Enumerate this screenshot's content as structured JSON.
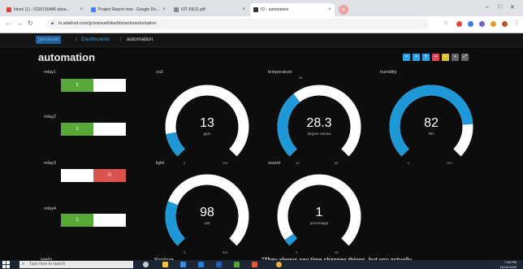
{
  "browser": {
    "tabs": [
      {
        "label": "Inbox (1) - 0120150486 adoa...",
        "color": "#d84437"
      },
      {
        "label": "Project Report new - Google Do...",
        "color": "#4285f4"
      },
      {
        "label": "IOT-65(1) pdf",
        "color": "#888888"
      },
      {
        "label": "IO - automation",
        "color": "#333333"
      }
    ],
    "new_tab": "+",
    "url": "io.adafruit.com/jyovwsuel/dashboards/automation",
    "window_controls": [
      "–",
      "□",
      "✕"
    ]
  },
  "app": {
    "breadcrumb": {
      "home": "jyovasuel",
      "sep": "/",
      "dashboards": "Dashboards",
      "current": "automation"
    },
    "title": "automation",
    "tool_icons": [
      {
        "name": "edit-icon",
        "glyph": "▪",
        "color": "#2aa5e6"
      },
      {
        "name": "settings-icon",
        "glyph": "▪",
        "color": "#2aa5e6"
      },
      {
        "name": "add-block-icon",
        "glyph": "+",
        "color": "#2aa5e6"
      },
      {
        "name": "delete-icon",
        "glyph": "▪",
        "color": "#e04a5a"
      },
      {
        "name": "key-icon",
        "glyph": "▪",
        "color": "#d9c531"
      },
      {
        "name": "lock-icon",
        "glyph": "▪",
        "color": "#666666"
      },
      {
        "name": "fullscreen-icon",
        "glyph": "⤢",
        "color": "#666666"
      }
    ],
    "relays": [
      {
        "label": "relay1",
        "on_text": "1",
        "off_text": "",
        "state": "on"
      },
      {
        "label": "relay2",
        "on_text": "1",
        "off_text": "",
        "state": "on"
      },
      {
        "label": "relay3",
        "on_text": "",
        "off_text": "0",
        "state": "off"
      },
      {
        "label": "relay4",
        "on_text": "1",
        "off_text": "",
        "state": "on"
      }
    ],
    "gauges": [
      {
        "label": "co2",
        "value": "13",
        "unit": "ppm",
        "min": "0",
        "max": "100",
        "mid": "",
        "fraction": 0.13
      },
      {
        "label": "temperature",
        "value": "28.3",
        "unit": "degree celcius",
        "min": "16",
        "max": "50",
        "mid": "26",
        "fraction": 0.36
      },
      {
        "label": "humidity",
        "value": "82",
        "unit": "RH",
        "min": "0",
        "max": "100",
        "mid": "",
        "fraction": 0.82
      },
      {
        "label": "light",
        "value": "98",
        "unit": "unit",
        "min": "0",
        "max": "400",
        "mid": "",
        "fraction": 0.245
      },
      {
        "label": "sound",
        "value": "1",
        "unit": "percentage",
        "min": "0",
        "max": "25",
        "mid": "",
        "fraction": 0.04
      }
    ],
    "footer": {
      "help": "Help",
      "explore": "Explore",
      "quote": "\"They always say time changes things, but you actually..."
    },
    "colors": {
      "accent": "#1f98d8",
      "on": "#58a838",
      "off": "#d9534f",
      "track": "#ffffff"
    }
  },
  "taskbar": {
    "search_placeholder": "Type here to search",
    "time": "7:30 PM",
    "date": "16-04-2023"
  }
}
